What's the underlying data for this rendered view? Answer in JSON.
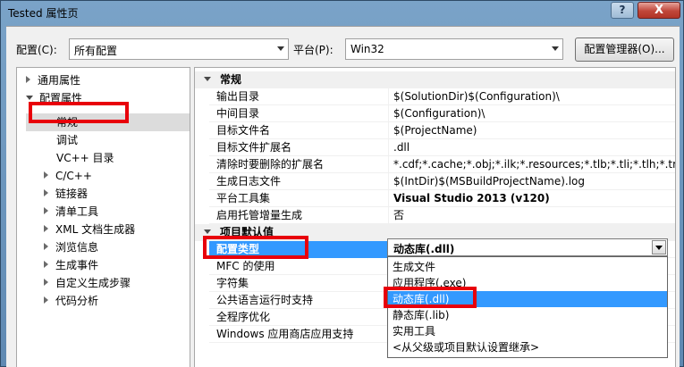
{
  "window": {
    "title": "Tested 属性页",
    "help_button": "?",
    "close_button": "X"
  },
  "config_bar": {
    "config_label": "配置(C):",
    "config_value": "所有配置",
    "platform_label": "平台(P):",
    "platform_value": "Win32",
    "config_manager_button": "配置管理器(O)..."
  },
  "tree": {
    "items": [
      {
        "label": "通用属性"
      },
      {
        "label": "配置属性"
      },
      {
        "label": "常规"
      },
      {
        "label": "调试"
      },
      {
        "label": "VC++ 目录"
      },
      {
        "label": "C/C++"
      },
      {
        "label": "链接器"
      },
      {
        "label": "清单工具"
      },
      {
        "label": "XML 文档生成器"
      },
      {
        "label": "浏览信息"
      },
      {
        "label": "生成事件"
      },
      {
        "label": "自定义生成步骤"
      },
      {
        "label": "代码分析"
      }
    ]
  },
  "grid": {
    "category_general": "常规",
    "rows_general": [
      {
        "name": "输出目录",
        "value": "$(SolutionDir)$(Configuration)\\"
      },
      {
        "name": "中间目录",
        "value": "$(Configuration)\\"
      },
      {
        "name": "目标文件名",
        "value": "$(ProjectName)"
      },
      {
        "name": "目标文件扩展名",
        "value": ".dll"
      },
      {
        "name": "清除时要删除的扩展名",
        "value": "*.cdf;*.cache;*.obj;*.ilk;*.resources;*.tlb;*.tli;*.tlh;*.tmp;*"
      },
      {
        "name": "生成日志文件",
        "value": "$(IntDir)$(MSBuildProjectName).log"
      },
      {
        "name": "平台工具集",
        "value": "Visual Studio 2013 (v120)"
      },
      {
        "name": "启用托管增量生成",
        "value": "否"
      }
    ],
    "category_defaults": "项目默认值",
    "rows_defaults": [
      {
        "name": "配置类型"
      },
      {
        "name": "MFC 的使用"
      },
      {
        "name": "字符集"
      },
      {
        "name": "公共语言运行时支持"
      },
      {
        "name": "全程序优化"
      },
      {
        "name": "Windows 应用商店应用支持"
      }
    ]
  },
  "dropdown": {
    "current_value": "动态库(.dll)",
    "options": [
      {
        "label": "生成文件"
      },
      {
        "label": "应用程序(.exe)"
      },
      {
        "label": "动态库(.dll)"
      },
      {
        "label": "静态库(.lib)"
      },
      {
        "label": "实用工具"
      },
      {
        "label": "<从父级或项目默认设置继承>"
      }
    ]
  },
  "colors": {
    "selection": "#3399ff",
    "annotation_red": "#e8000b"
  }
}
